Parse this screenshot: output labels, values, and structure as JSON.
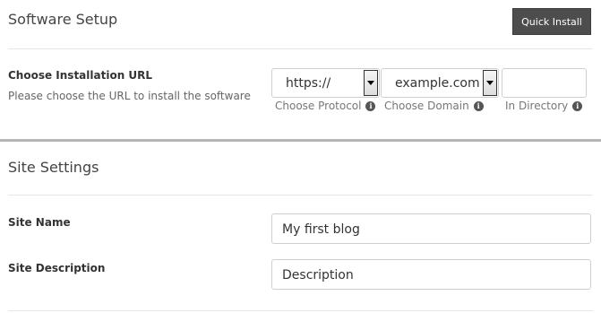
{
  "software_setup": {
    "title": "Software Setup",
    "quick_install_label": "Quick Install",
    "install_url": {
      "label": "Choose Installation URL",
      "sublabel": "Please choose the URL to install the software",
      "protocol": {
        "value": "https://",
        "hint": "Choose Protocol"
      },
      "domain": {
        "value": "example.com",
        "hint": "Choose Domain"
      },
      "directory": {
        "value": "",
        "hint": "In Directory"
      }
    }
  },
  "site_settings": {
    "title": "Site Settings",
    "site_name": {
      "label": "Site Name",
      "value": "My first blog"
    },
    "site_description": {
      "label": "Site Description",
      "value": "Description"
    }
  },
  "icons": {
    "info": "info-icon",
    "dropdown": "chevron-down-icon"
  },
  "colors": {
    "button_bg": "#4d4d4d",
    "divider": "#b5b5b5"
  }
}
